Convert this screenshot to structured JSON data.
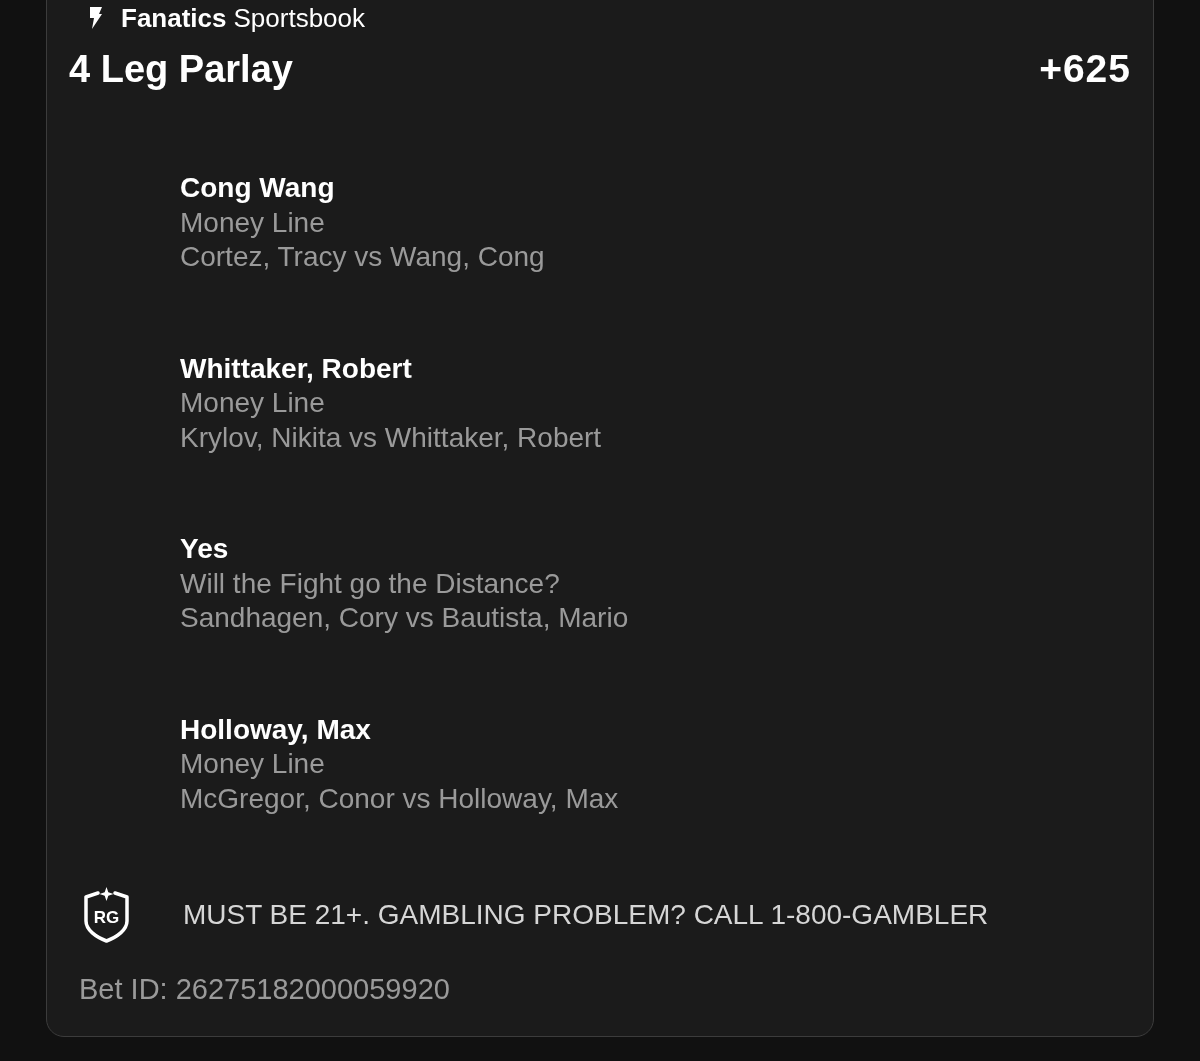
{
  "header_logo": {
    "brand": "Fanatics",
    "product": "Sportsbook"
  },
  "bet": {
    "title": "4 Leg Parlay",
    "odds": "+625"
  },
  "legs": [
    {
      "selection": "Cong Wang",
      "market": "Money Line",
      "event": "Cortez, Tracy vs Wang, Cong"
    },
    {
      "selection": "Whittaker, Robert",
      "market": "Money Line",
      "event": "Krylov, Nikita vs Whittaker, Robert"
    },
    {
      "selection": "Yes",
      "market": "Will the Fight go the Distance?",
      "event": "Sandhagen, Cory vs Bautista, Mario"
    },
    {
      "selection": "Holloway, Max",
      "market": "Money Line",
      "event": "McGregor, Conor vs Holloway, Max"
    }
  ],
  "disclaimer": {
    "badge": "RG",
    "text": "MUST BE 21+. GAMBLING PROBLEM? CALL 1-800-GAMBLER"
  },
  "bet_id": "Bet ID: 26275182000059920"
}
